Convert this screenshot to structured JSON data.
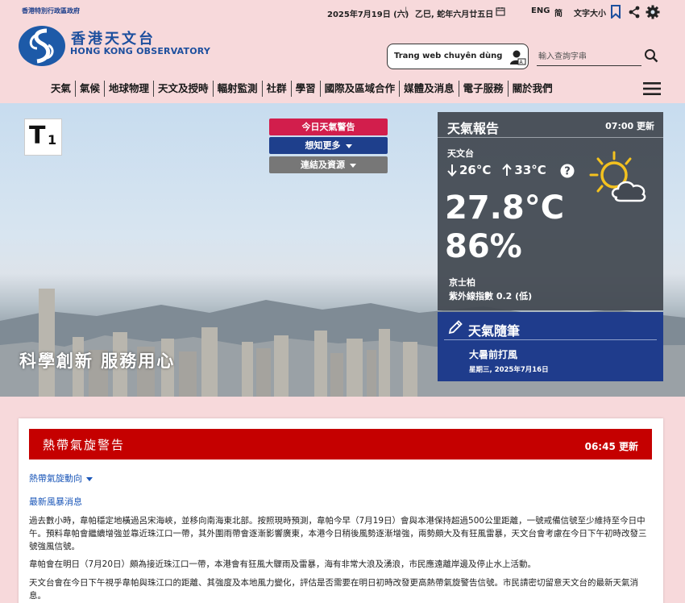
{
  "header": {
    "govt": "香港特別行政區政府",
    "date": "2025年7月19日 (六)",
    "separator": "|",
    "lunar": "乙巳, 蛇年六月廿五日",
    "lang_eng": "ENG",
    "lang_simplified": "简",
    "font_size": "文字大小"
  },
  "logo": {
    "zh": "香港天文台",
    "en": "HONG KONG OBSERVATORY"
  },
  "translate": {
    "label": "Trang web chuyên dùng"
  },
  "search": {
    "placeholder": "輸入查詢字串"
  },
  "nav": {
    "items": [
      "天氣",
      "氣候",
      "地球物理",
      "天文及授時",
      "輻射監測",
      "社群",
      "學習",
      "國際及區域合作",
      "媒體及消息",
      "電子服務",
      "關於我們"
    ]
  },
  "hero": {
    "slogan": "科學創新 服務用心",
    "signal_letter": "T",
    "signal_number": "1",
    "buttons": {
      "warnings": "今日天氣警告",
      "more": "想知更多",
      "links": "連結及資源"
    }
  },
  "weather_report": {
    "title": "天氣報告",
    "time": "07:00 更新",
    "station": "天文台",
    "min_temp": "26°C",
    "max_temp": "33°C",
    "temperature": "27.8°C",
    "humidity": "86%",
    "uv_station": "京士柏",
    "uv_index": "紫外線指數 0.2 (低)"
  },
  "jottings": {
    "title": "天氣隨筆",
    "item": "大暑前打風",
    "date": "星期三, 2025年7月16日"
  },
  "warning_card": {
    "title": "熱帶氣旋警告",
    "time": "06:45 更新",
    "link_track": "熱帶氣旋動向",
    "link_news": "最新風暴消息",
    "para1": "過去數小時，韋帕穩定地橫過呂宋海峽，並移向南海東北部。按照現時預測，韋帕今早（7月19日）會與本港保持超過500公里距離，一號戒備信號至少維持至今日中午。預料韋帕會繼續增強並靠近珠江口一帶，其外圍雨帶會逐漸影響廣東，本港今日稍後風勢逐漸增強，兩勢頗大及有狂風雷暴，天文台會考慮在今日下午初時改發三號強風信號。",
    "para2": "韋帕會在明日（7月20日）頗為接近珠江口一帶，本港會有狂風大驟雨及雷暴，海有非常大浪及湧浪，市民應遠離岸邊及停止水上活動。",
    "para3": "天文台會在今日下午視乎韋帕與珠江口的距離、其強度及本地風力變化，評估是否需要在明日初時改發更高熱帶氣旋警告信號。市民請密切留意天文台的最新天氣消息。"
  },
  "colors": {
    "brand_blue": "#1d4f9e",
    "warning_red": "#c50000",
    "warning_button": "#d21e4c",
    "nav_blue": "#1e3f8c",
    "panel_gray": "#434952",
    "link_blue": "#1a56b8"
  },
  "icons": [
    "calendar-icon",
    "bookmark-icon",
    "share-icon",
    "gear-icon",
    "translate-icon",
    "search-icon",
    "menu-icon",
    "down-arrow-icon",
    "up-arrow-icon",
    "help-icon",
    "sun-cloud-icon",
    "pencil-icon"
  ]
}
